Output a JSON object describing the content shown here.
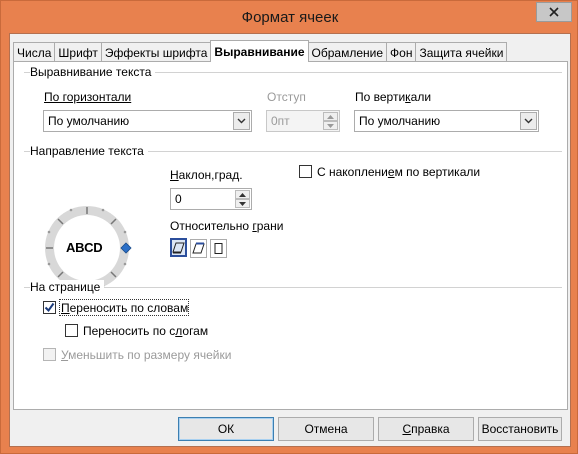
{
  "window": {
    "title": "Формат ячеек"
  },
  "tabs": [
    {
      "label": "Числа",
      "active": false
    },
    {
      "label": "Шрифт",
      "active": false
    },
    {
      "label": "Эффекты шрифта",
      "active": false
    },
    {
      "label": "Выравнивание",
      "active": true
    },
    {
      "label": "Обрамление",
      "active": false
    },
    {
      "label": "Фон",
      "active": false
    },
    {
      "label": "Защита ячейки",
      "active": false
    }
  ],
  "text_alignment": {
    "group_title": "Выравнивание текста",
    "horizontal_label": "По горизонтали",
    "horizontal_value": "По умолчанию",
    "indent_label": "Отступ",
    "indent_value": "0пт",
    "vertical_label": "По вертикали",
    "vertical_value": "По умолчанию"
  },
  "text_direction": {
    "group_title": "Направление текста",
    "dial_text": "ABCD",
    "angle_label": "Наклон,град.",
    "angle_value": "0",
    "stacked_label": "С накоплением по вертикали",
    "stacked_checked": false,
    "reference_edge_label": "Относительно грани"
  },
  "on_page": {
    "group_title": "На странице",
    "wrap_words_label": "Переносить по словам",
    "wrap_words_checked": true,
    "hyphenation_label": "Переносить по слогам",
    "hyphenation_checked": false,
    "shrink_label": "Уменьшить по размеру ячейки",
    "shrink_checked": false,
    "shrink_enabled": false
  },
  "buttons": {
    "ok": "ОК",
    "cancel": "Отмена",
    "help": "Справка",
    "reset": "Восстановить"
  }
}
